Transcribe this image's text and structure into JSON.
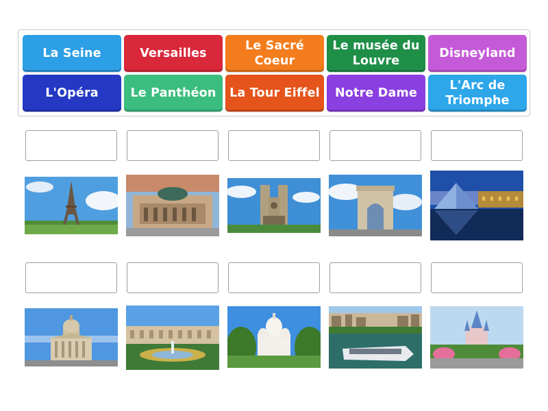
{
  "word_bank": {
    "tiles": [
      {
        "label": "La Seine",
        "color": "#2d9fe6"
      },
      {
        "label": "Versailles",
        "color": "#d9283a"
      },
      {
        "label": "Le Sacré Coeur",
        "color": "#f37c1c"
      },
      {
        "label": "Le musée du Louvre",
        "color": "#1f8f48"
      },
      {
        "label": "Disneyland",
        "color": "#c55ad8"
      },
      {
        "label": "L'Opéra",
        "color": "#2438c4"
      },
      {
        "label": "Le Panthéon",
        "color": "#3bbd7f"
      },
      {
        "label": "La Tour Eiffel",
        "color": "#e4541b"
      },
      {
        "label": "Notre Dame",
        "color": "#8a3fe0"
      },
      {
        "label": "L'Arc de Triomphe",
        "color": "#2da6ea"
      }
    ]
  },
  "matching_items": {
    "row1": [
      {
        "image": "eiffel-tower-photo"
      },
      {
        "image": "opera-garnier-photo"
      },
      {
        "image": "notre-dame-photo"
      },
      {
        "image": "arc-de-triomphe-photo"
      },
      {
        "image": "louvre-pyramid-photo"
      }
    ],
    "row2": [
      {
        "image": "pantheon-photo"
      },
      {
        "image": "versailles-photo"
      },
      {
        "image": "sacre-coeur-photo"
      },
      {
        "image": "seine-boat-photo"
      },
      {
        "image": "disneyland-castle-photo"
      }
    ]
  }
}
